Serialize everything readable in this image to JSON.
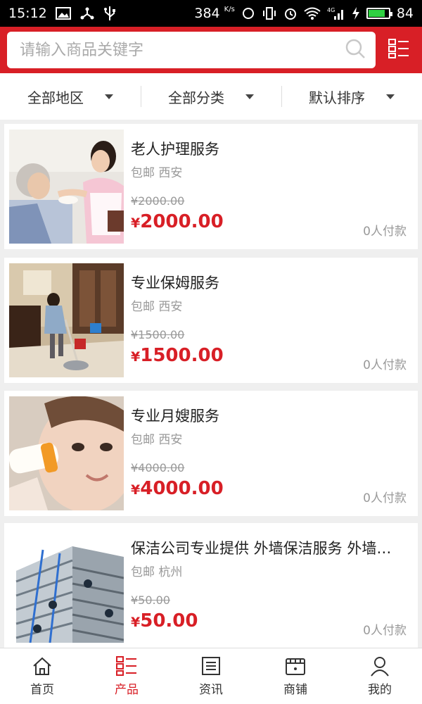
{
  "status_bar": {
    "time": "15:12",
    "net_speed": "384",
    "net_unit": "K/s",
    "network": "4G",
    "battery": "84",
    "battery_level": 0.84
  },
  "search": {
    "placeholder": "请输入商品关键字"
  },
  "filters": [
    {
      "label": "全部地区"
    },
    {
      "label": "全部分类"
    },
    {
      "label": "默认排序"
    }
  ],
  "products": [
    {
      "title": "老人护理服务",
      "shipping": "包邮 西安",
      "old_price": "¥2000.00",
      "currency": "¥",
      "price": "2000.00",
      "paid": "0人付款"
    },
    {
      "title": "专业保姆服务",
      "shipping": "包邮 西安",
      "old_price": "¥1500.00",
      "currency": "¥",
      "price": "1500.00",
      "paid": "0人付款"
    },
    {
      "title": "专业月嫂服务",
      "shipping": "包邮 西安",
      "old_price": "¥4000.00",
      "currency": "¥",
      "price": "4000.00",
      "paid": "0人付款"
    },
    {
      "title": "保洁公司专业提供 外墙保洁服务 外墙…",
      "shipping": "包邮 杭州",
      "old_price": "¥50.00",
      "currency": "¥",
      "price": "50.00",
      "paid": "0人付款"
    }
  ],
  "nav": [
    {
      "label": "首页",
      "icon": "home-icon"
    },
    {
      "label": "产品",
      "icon": "product-list-icon",
      "active": true
    },
    {
      "label": "资讯",
      "icon": "news-icon"
    },
    {
      "label": "商铺",
      "icon": "store-icon"
    },
    {
      "label": "我的",
      "icon": "user-icon"
    }
  ],
  "colors": {
    "brand": "#d81f26",
    "price": "#d81f26",
    "muted": "#999999"
  }
}
